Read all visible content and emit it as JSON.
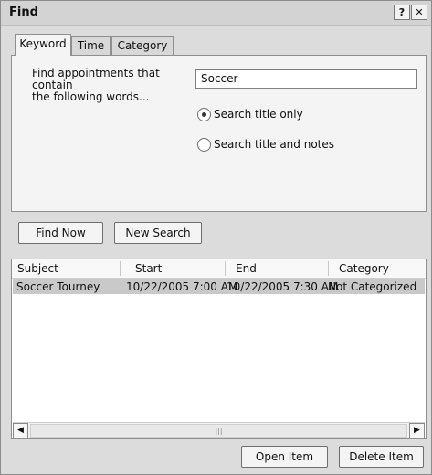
{
  "window": {
    "title": "Find",
    "help_label": "?",
    "close_label": "✕"
  },
  "tabs": [
    {
      "label": "Keyword",
      "active": true
    },
    {
      "label": "Time",
      "active": false
    },
    {
      "label": "Category",
      "active": false
    }
  ],
  "keyword": {
    "description_line1": "Find appointments that contain",
    "description_line2": "the following words...",
    "search_value": "Soccer",
    "radio_title_only": {
      "label": "Search title only",
      "checked": true
    },
    "radio_title_notes": {
      "label": "Search title and notes",
      "checked": false
    }
  },
  "buttons": {
    "find_now": "Find Now",
    "new_search": "New Search",
    "open_item": "Open Item",
    "delete_item": "Delete Item"
  },
  "results": {
    "columns": [
      "Subject",
      "Start",
      "End",
      "Category"
    ],
    "rows": [
      {
        "subject": "Soccer Tourney",
        "start": "10/22/2005 7:00 AM",
        "end": "10/22/2005 7:30 AM",
        "category": "Not Categorized"
      }
    ]
  },
  "scrollbar": {
    "left_icon": "◀",
    "right_icon": "▶",
    "grip": "|||"
  }
}
